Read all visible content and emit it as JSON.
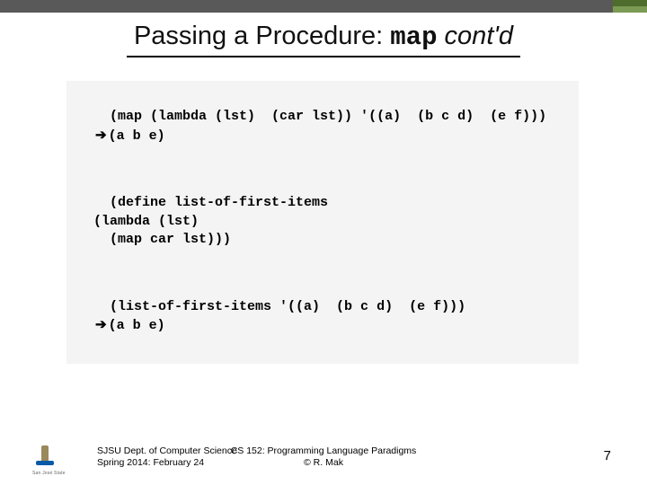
{
  "title": {
    "prefix": "Passing a Procedure: ",
    "code": "map",
    "suffix": " cont'd"
  },
  "code": {
    "line1": "(map (lambda (lst)  (car lst)) '((a)  (b c d)  (e f)))",
    "arrow": "➔",
    "res1": "(a b e)",
    "def_l1": "(define list-of-first-items",
    "def_l2": "  (lambda (lst)",
    "def_l3": "    (map car lst)))",
    "call": "(list-of-first-items '((a)  (b c d)  (e f)))",
    "res2": "(a b e)"
  },
  "footer": {
    "left_l1": "SJSU Dept. of Computer Science",
    "left_l2": "Spring 2014: February 24",
    "center_l1": "CS 152: Programming Language Paradigms",
    "center_l2": "© R. Mak",
    "logo_text": "San José State",
    "page": "7"
  }
}
